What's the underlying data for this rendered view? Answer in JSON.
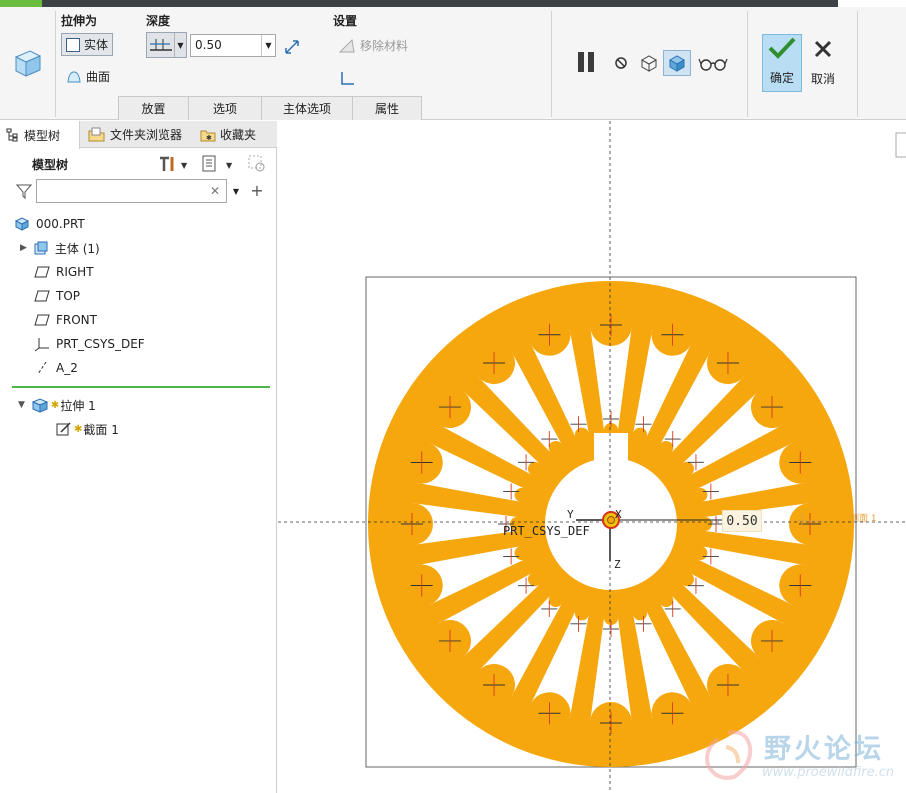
{
  "dashboard": {
    "extrude_as": {
      "title": "拉伸为",
      "solid": "实体",
      "surface": "曲面"
    },
    "depth": {
      "title": "深度",
      "value": "0.50"
    },
    "settings": {
      "title": "设置",
      "remove_material": "移除材料"
    },
    "tabs": [
      {
        "label": "放置",
        "name": "tab-placement"
      },
      {
        "label": "选项",
        "name": "tab-options"
      },
      {
        "label": "主体选项",
        "name": "tab-body-options"
      },
      {
        "label": "属性",
        "name": "tab-properties"
      }
    ],
    "confirm": "确定",
    "cancel": "取消"
  },
  "panel": {
    "tabs": {
      "model_tree": "模型树",
      "folder_browser": "文件夹浏览器",
      "favorites": "收藏夹"
    },
    "tree_header": "模型树",
    "filter_placeholder": "",
    "items": [
      {
        "label": "000.PRT",
        "icon": "part-icon",
        "name": "tree-item-part"
      },
      {
        "label": "主体 (1)",
        "icon": "body-icon",
        "name": "tree-item-bodies"
      },
      {
        "label": "RIGHT",
        "icon": "datum-plane-icon",
        "name": "tree-item-right"
      },
      {
        "label": "TOP",
        "icon": "datum-plane-icon",
        "name": "tree-item-top"
      },
      {
        "label": "FRONT",
        "icon": "datum-plane-icon",
        "name": "tree-item-front"
      },
      {
        "label": "PRT_CSYS_DEF",
        "icon": "csys-icon",
        "name": "tree-item-csys"
      },
      {
        "label": "A_2",
        "icon": "datum-axis-icon",
        "name": "tree-item-axis"
      }
    ],
    "insert_items": [
      {
        "label": "拉伸 1",
        "icon": "extrude-icon",
        "name": "tree-item-extrude"
      },
      {
        "label": "截面 1",
        "icon": "sketch-icon",
        "name": "tree-item-section"
      }
    ]
  },
  "canvas": {
    "csys_label": "PRT_CSYS_DEF",
    "axis_x": "X",
    "axis_y": "Y",
    "axis_z": "Z",
    "depth_dimension": "0.50",
    "side_label": "侧面 1",
    "part_color": "#f5a70d"
  },
  "watermark": {
    "cn": "野火论坛",
    "url": "www.proewildfire.cn"
  }
}
